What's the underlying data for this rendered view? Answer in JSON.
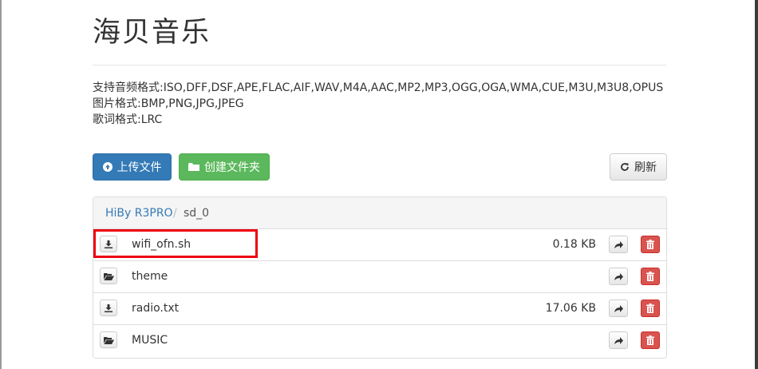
{
  "header": {
    "title": "海贝音乐"
  },
  "formats": {
    "audio": "支持音频格式:ISO,DFF,DSF,APE,FLAC,AIF,WAV,M4A,AAC,MP2,MP3,OGG,OGA,WMA,CUE,M3U,M3U8,OPUS",
    "image": "图片格式:BMP,PNG,JPG,JPEG",
    "lyrics": "歌词格式:LRC"
  },
  "toolbar": {
    "upload_label": "上传文件",
    "mkdir_label": "创建文件夹",
    "refresh_label": "刷新"
  },
  "breadcrumb": {
    "root": "HiBy R3PRO",
    "separator": "/",
    "current": "sd_0"
  },
  "files": [
    {
      "name": "wifi_ofn.sh",
      "size": "0.18 KB",
      "kind": "file",
      "icon": "download-icon"
    },
    {
      "name": "theme",
      "size": "",
      "kind": "folder",
      "icon": "folder-open-icon"
    },
    {
      "name": "radio.txt",
      "size": "17.06 KB",
      "kind": "file",
      "icon": "download-icon"
    },
    {
      "name": "MUSIC",
      "size": "",
      "kind": "folder",
      "icon": "folder-open-icon"
    }
  ],
  "colors": {
    "primary": "#337ab7",
    "success": "#5cb85c",
    "danger": "#d9534f",
    "highlight": "#ee0011"
  }
}
